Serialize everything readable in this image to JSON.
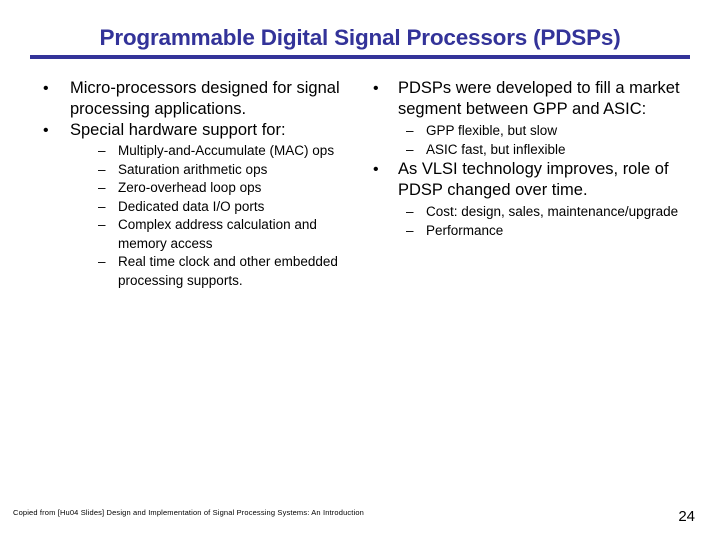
{
  "slide": {
    "title": "Programmable Digital Signal Processors (PDSPs)",
    "title_color": "#333399",
    "background_color": "#ffffff",
    "body_text_color": "#000000",
    "bullet_marker": "•",
    "sub_bullet_marker": "–"
  },
  "left_column": [
    {
      "text": "Micro-processors designed for signal processing applications.",
      "sub": []
    },
    {
      "text": "Special hardware support for:",
      "sub": [
        "Multiply-and-Accumulate (MAC) ops",
        "Saturation arithmetic ops",
        "Zero-overhead loop ops",
        "Dedicated data I/O ports",
        "Complex address calculation and memory access",
        "Real time clock and other embedded processing supports."
      ]
    }
  ],
  "right_column": [
    {
      "text": "PDSPs were developed to fill a market segment between GPP and ASIC:",
      "sub": [
        "GPP flexible, but slow",
        "ASIC fast, but inflexible"
      ]
    },
    {
      "text": "As VLSI technology improves, role of PDSP changed over time.",
      "sub": [
        "Cost: design, sales, maintenance/upgrade",
        "Performance"
      ]
    }
  ],
  "footer": {
    "note": "Copied from  [Hu04 Slides] Design and Implementation of Signal Processing Systems: An Introduction",
    "page_number": "24"
  }
}
